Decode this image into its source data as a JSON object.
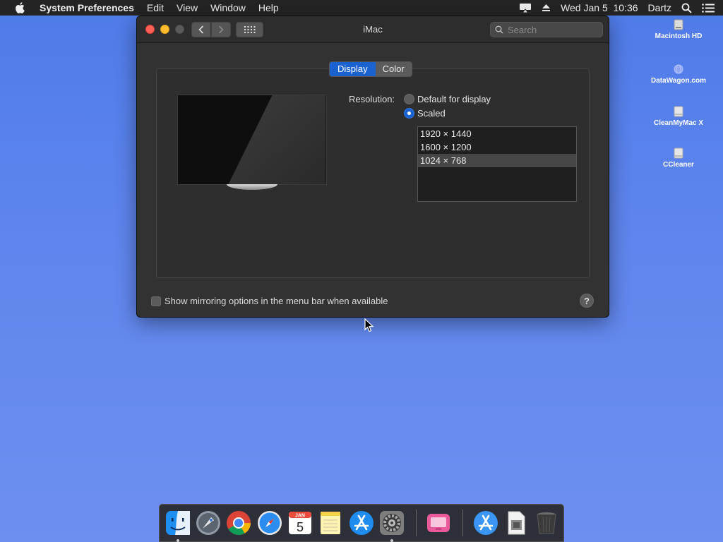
{
  "menubar": {
    "apple_icon": "apple-icon",
    "app_name": "System Preferences",
    "menus": [
      "Edit",
      "View",
      "Window",
      "Help"
    ],
    "status_icons": [
      "airplay-icon",
      "eject-icon"
    ],
    "clock": "Wed Jan 5  10:36",
    "user": "Dartz",
    "right_icons": [
      "spotlight-search-icon",
      "notification-center-icon"
    ]
  },
  "desktop": {
    "icons": [
      {
        "label": "Macintosh HD",
        "icon": "hard-drive-icon"
      },
      {
        "label": "DataWagon.com",
        "icon": "network-volume-icon"
      },
      {
        "label": "CleanMyMac X",
        "icon": "disk-image-icon"
      },
      {
        "label": "CCleaner",
        "icon": "disk-image-icon"
      }
    ]
  },
  "window": {
    "title": "iMac",
    "search_placeholder": "Search",
    "tabs": [
      {
        "label": "Display",
        "active": true
      },
      {
        "label": "Color",
        "active": false
      }
    ],
    "resolution_label": "Resolution:",
    "resolution_options": [
      {
        "label": "Default for display",
        "selected": false
      },
      {
        "label": "Scaled",
        "selected": true
      }
    ],
    "scaled_resolutions": [
      {
        "label": "1920 × 1440",
        "selected": false
      },
      {
        "label": "1600 × 1200",
        "selected": false
      },
      {
        "label": "1024 × 768",
        "selected": true
      }
    ],
    "mirroring_checkbox_label": "Show mirroring options in the menu bar when available",
    "mirroring_checked": false,
    "help_label": "?"
  },
  "dock": {
    "apps": [
      {
        "name": "Finder",
        "icon": "finder-icon",
        "running": true
      },
      {
        "name": "Launchpad",
        "icon": "launchpad-icon",
        "running": false
      },
      {
        "name": "Google Chrome",
        "icon": "chrome-icon",
        "running": false
      },
      {
        "name": "Safari",
        "icon": "safari-icon",
        "running": false
      },
      {
        "name": "Calendar",
        "icon": "calendar-icon",
        "running": false,
        "month": "JAN",
        "day": "5"
      },
      {
        "name": "Notes",
        "icon": "notes-icon",
        "running": false
      },
      {
        "name": "App Store",
        "icon": "app-store-icon",
        "running": false
      },
      {
        "name": "System Preferences",
        "icon": "system-preferences-icon",
        "running": true
      },
      {
        "name": "CleanMyMac X",
        "icon": "cleanmymac-icon",
        "running": false
      },
      {
        "name": "Applications",
        "icon": "applications-folder-icon",
        "running": false
      },
      {
        "name": "Documents",
        "icon": "documents-stack-icon",
        "running": false
      },
      {
        "name": "Trash",
        "icon": "trash-icon",
        "running": false
      }
    ]
  },
  "colors": {
    "desktop_top": "#4f7be8",
    "desktop_bottom": "#6d8ff0",
    "accent": "#1b62d1",
    "window_bg": "#323232",
    "menubar_bg": "#242424"
  }
}
